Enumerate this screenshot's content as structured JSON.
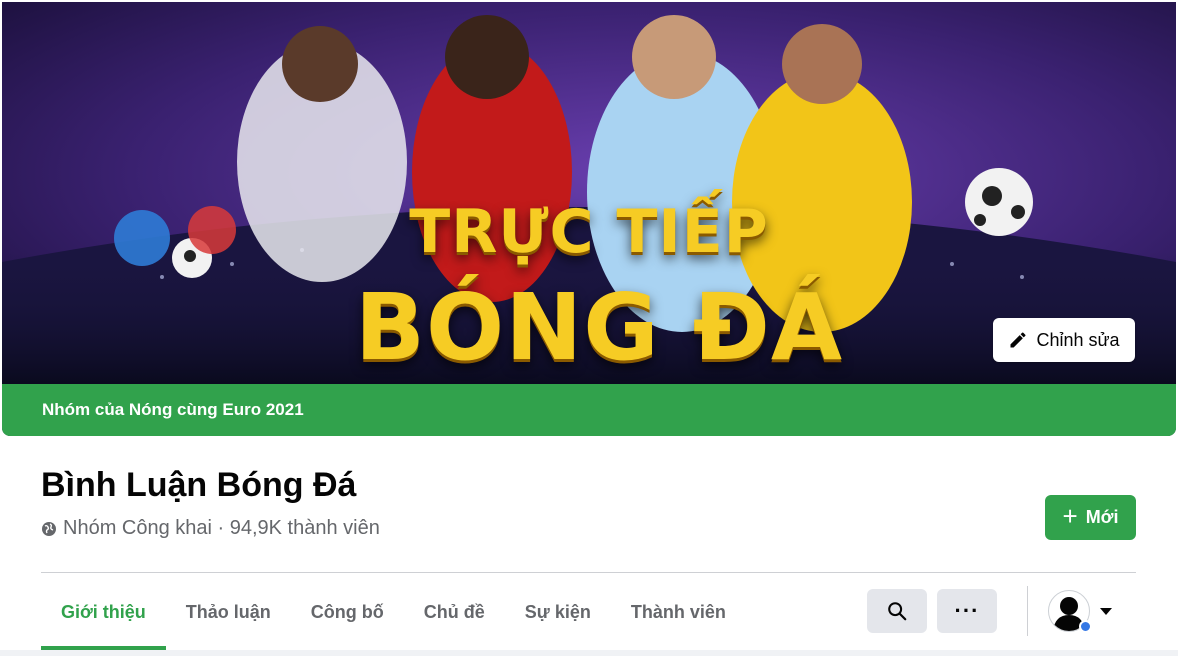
{
  "cover": {
    "headline_line1": "TRỰC TIẾP",
    "headline_line2": "BÓNG ĐÁ",
    "edit_label": "Chỉnh sửa",
    "bar_text": "Nhóm của Nóng cùng Euro 2021",
    "bar_color": "#31a24c"
  },
  "group": {
    "name": "Bình Luận Bóng Đá",
    "privacy_icon": "globe-icon",
    "meta": "Nhóm Công khai · 94,9K thành viên",
    "new_label": "Mới"
  },
  "tabs": [
    {
      "label": "Giới thiệu",
      "active": true
    },
    {
      "label": "Thảo luận",
      "active": false
    },
    {
      "label": "Công bố",
      "active": false
    },
    {
      "label": "Chủ đề",
      "active": false
    },
    {
      "label": "Sự kiện",
      "active": false
    },
    {
      "label": "Thành viên",
      "active": false
    }
  ],
  "toolbar": {
    "search_icon": "search-icon",
    "more_label": "···",
    "profile_icon": "avatar",
    "dropdown_icon": "caret-down-icon"
  },
  "colors": {
    "accent": "#31a24c",
    "text_secondary": "#65676b",
    "button_gray": "#e4e6eb"
  }
}
